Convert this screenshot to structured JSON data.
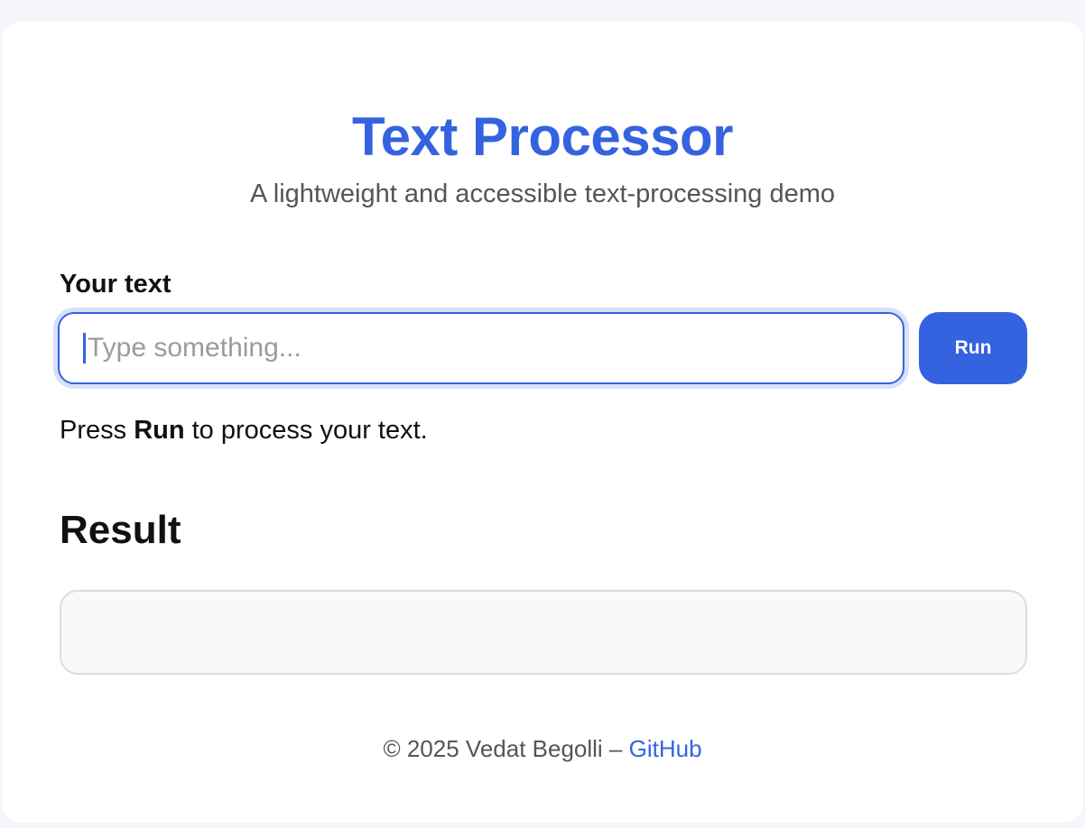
{
  "header": {
    "title": "Text Processor",
    "subtitle": "A lightweight and accessible text-processing demo"
  },
  "form": {
    "label": "Your text",
    "input_value": "",
    "input_placeholder": "Type something...",
    "run_label": "Run",
    "hint_prefix": "Press ",
    "hint_bold": "Run",
    "hint_suffix": " to process your text."
  },
  "result": {
    "heading": "Result",
    "content": ""
  },
  "footer": {
    "copyright": "© 2025 Vedat Begolli – ",
    "link_label": "GitHub"
  },
  "colors": {
    "accent": "#3563e0",
    "background": "#f4f6fb",
    "card": "#ffffff",
    "result_box": "#f9f9f9"
  },
  "icons": {
    "input_caret": "text-caret"
  }
}
